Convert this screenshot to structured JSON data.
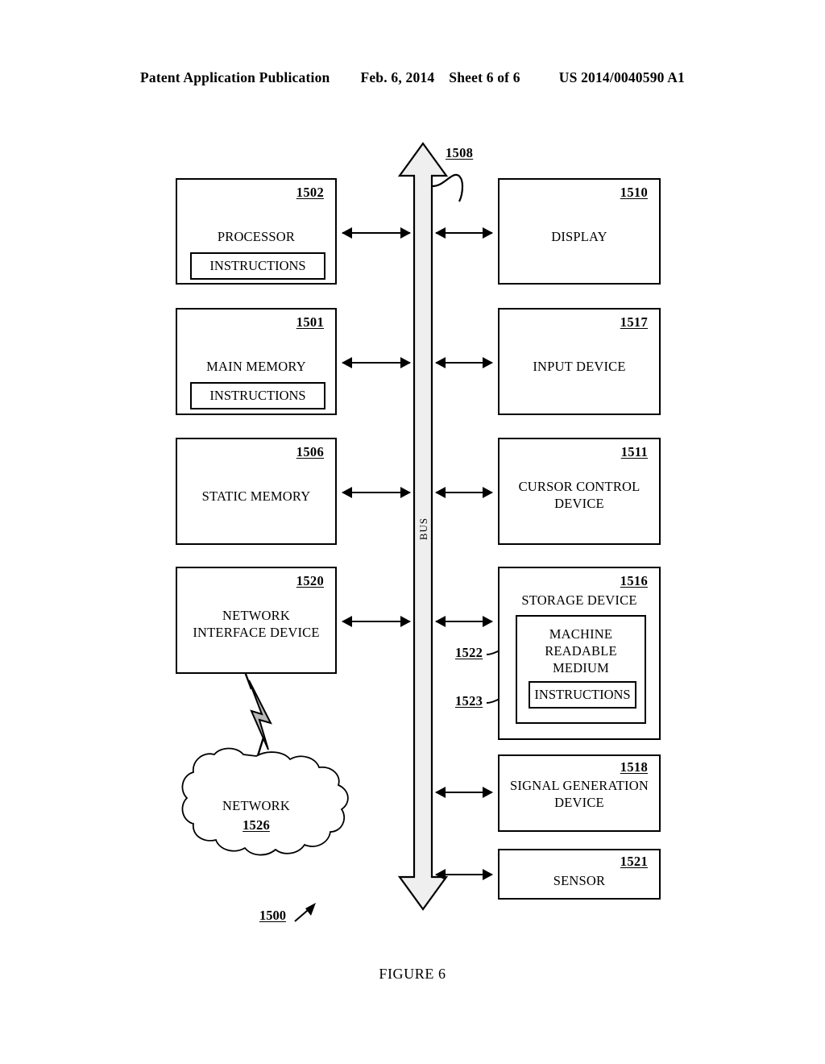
{
  "header": {
    "publication": "Patent Application Publication",
    "date": "Feb. 6, 2014",
    "sheet": "Sheet 6 of 6",
    "docnum": "US 2014/0040590 A1"
  },
  "figure": {
    "caption": "FIGURE 6",
    "system_ref": "1500",
    "bus": {
      "ref": "1508",
      "label": "BUS"
    },
    "left_column": [
      {
        "ref": "1502",
        "label": "PROCESSOR",
        "inner": {
          "label": "INSTRUCTIONS"
        }
      },
      {
        "ref": "1501",
        "label": "MAIN MEMORY",
        "inner": {
          "label": "INSTRUCTIONS"
        }
      },
      {
        "ref": "1506",
        "label": "STATIC MEMORY",
        "inner": null
      },
      {
        "ref": "1520",
        "label": "NETWORK\nINTERFACE DEVICE",
        "label_line1": "NETWORK",
        "label_line2": "INTERFACE DEVICE",
        "inner": null
      }
    ],
    "right_column": [
      {
        "ref": "1510",
        "label": "DISPLAY"
      },
      {
        "ref": "1517",
        "label": "INPUT DEVICE"
      },
      {
        "ref": "1511",
        "label_line1": "CURSOR CONTROL",
        "label_line2": "DEVICE"
      },
      {
        "ref": "1516",
        "label": "STORAGE DEVICE"
      },
      {
        "ref": "1518",
        "label_line1": "SIGNAL GENERATION",
        "label_line2": "DEVICE"
      },
      {
        "ref": "1521",
        "label": "SENSOR"
      }
    ],
    "storage_children": [
      {
        "ref": "1522",
        "label_line1": "MACHINE",
        "label_line2": "READABLE",
        "label_line3": "MEDIUM"
      },
      {
        "ref": "1523",
        "label": "INSTRUCTIONS"
      }
    ],
    "network_cloud": {
      "label": "NETWORK",
      "ref": "1526"
    }
  },
  "colors": {
    "ink": "#000000",
    "paper": "#ffffff",
    "bus_fill": "#efefef",
    "bolt_fill": "#b8b8b8"
  }
}
